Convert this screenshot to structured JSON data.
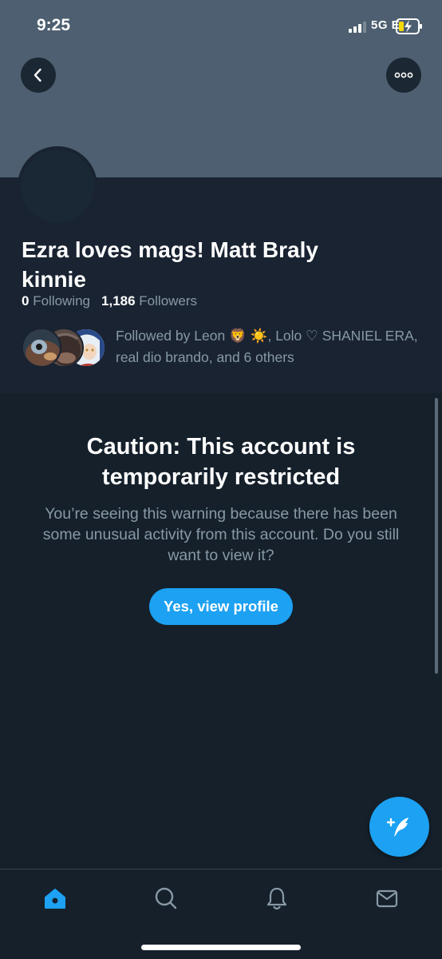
{
  "status_bar": {
    "time": "9:25",
    "network": "5G E",
    "signal_bars_active": 3,
    "battery_charging": true
  },
  "header": {
    "back_icon": "chevron-left-icon",
    "more_icon": "more-horizontal-icon"
  },
  "profile": {
    "display_name": "Ezra loves mags! Matt Braly kinnie",
    "following_count": "0",
    "following_label": "Following",
    "followers_count": "1,186",
    "followers_label": "Followers",
    "followed_by_text": "Followed by Leon 🦁 ☀️, Lolo ♡ SHANIEL ERA, real dio brando, and 6 others"
  },
  "caution": {
    "title": "Caution: This account is temporarily restricted",
    "body": "You’re seeing this warning because there has been some unusual activity from this account. Do you still want to view it?",
    "button_label": "Yes, view profile"
  },
  "fab": {
    "icon": "compose-tweet-icon"
  },
  "tab_bar": {
    "items": [
      {
        "name": "home",
        "icon": "home-icon",
        "active": true
      },
      {
        "name": "search",
        "icon": "search-icon",
        "active": false
      },
      {
        "name": "notifications",
        "icon": "bell-icon",
        "active": false
      },
      {
        "name": "messages",
        "icon": "mail-icon",
        "active": false
      }
    ]
  },
  "colors": {
    "background": "#15202b",
    "profile_bg": "#192331",
    "banner": "#4d5f70",
    "accent": "#1da1f2",
    "secondary_text": "#8899a6"
  }
}
